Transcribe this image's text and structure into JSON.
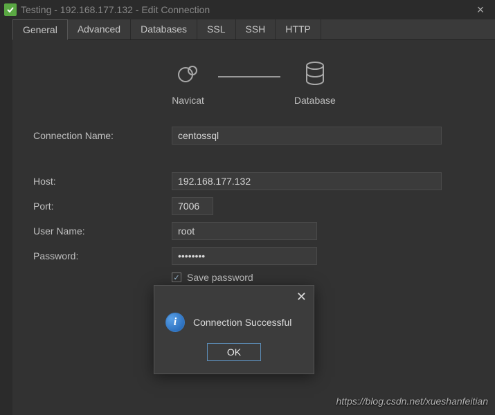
{
  "window": {
    "title": "Testing - 192.168.177.132 - Edit Connection"
  },
  "tabs": [
    "General",
    "Advanced",
    "Databases",
    "SSL",
    "SSH",
    "HTTP"
  ],
  "diagram": {
    "left": "Navicat",
    "right": "Database"
  },
  "form": {
    "conn_name_label": "Connection Name:",
    "conn_name_value": "centossql",
    "host_label": "Host:",
    "host_value": "192.168.177.132",
    "port_label": "Port:",
    "port_value": "7006",
    "user_label": "User Name:",
    "user_value": "root",
    "pass_label": "Password:",
    "pass_value": "••••••••",
    "save_pass_label": "Save password"
  },
  "modal": {
    "message": "Connection Successful",
    "ok": "OK"
  },
  "watermark": "https://blog.csdn.net/xueshanfeitian"
}
